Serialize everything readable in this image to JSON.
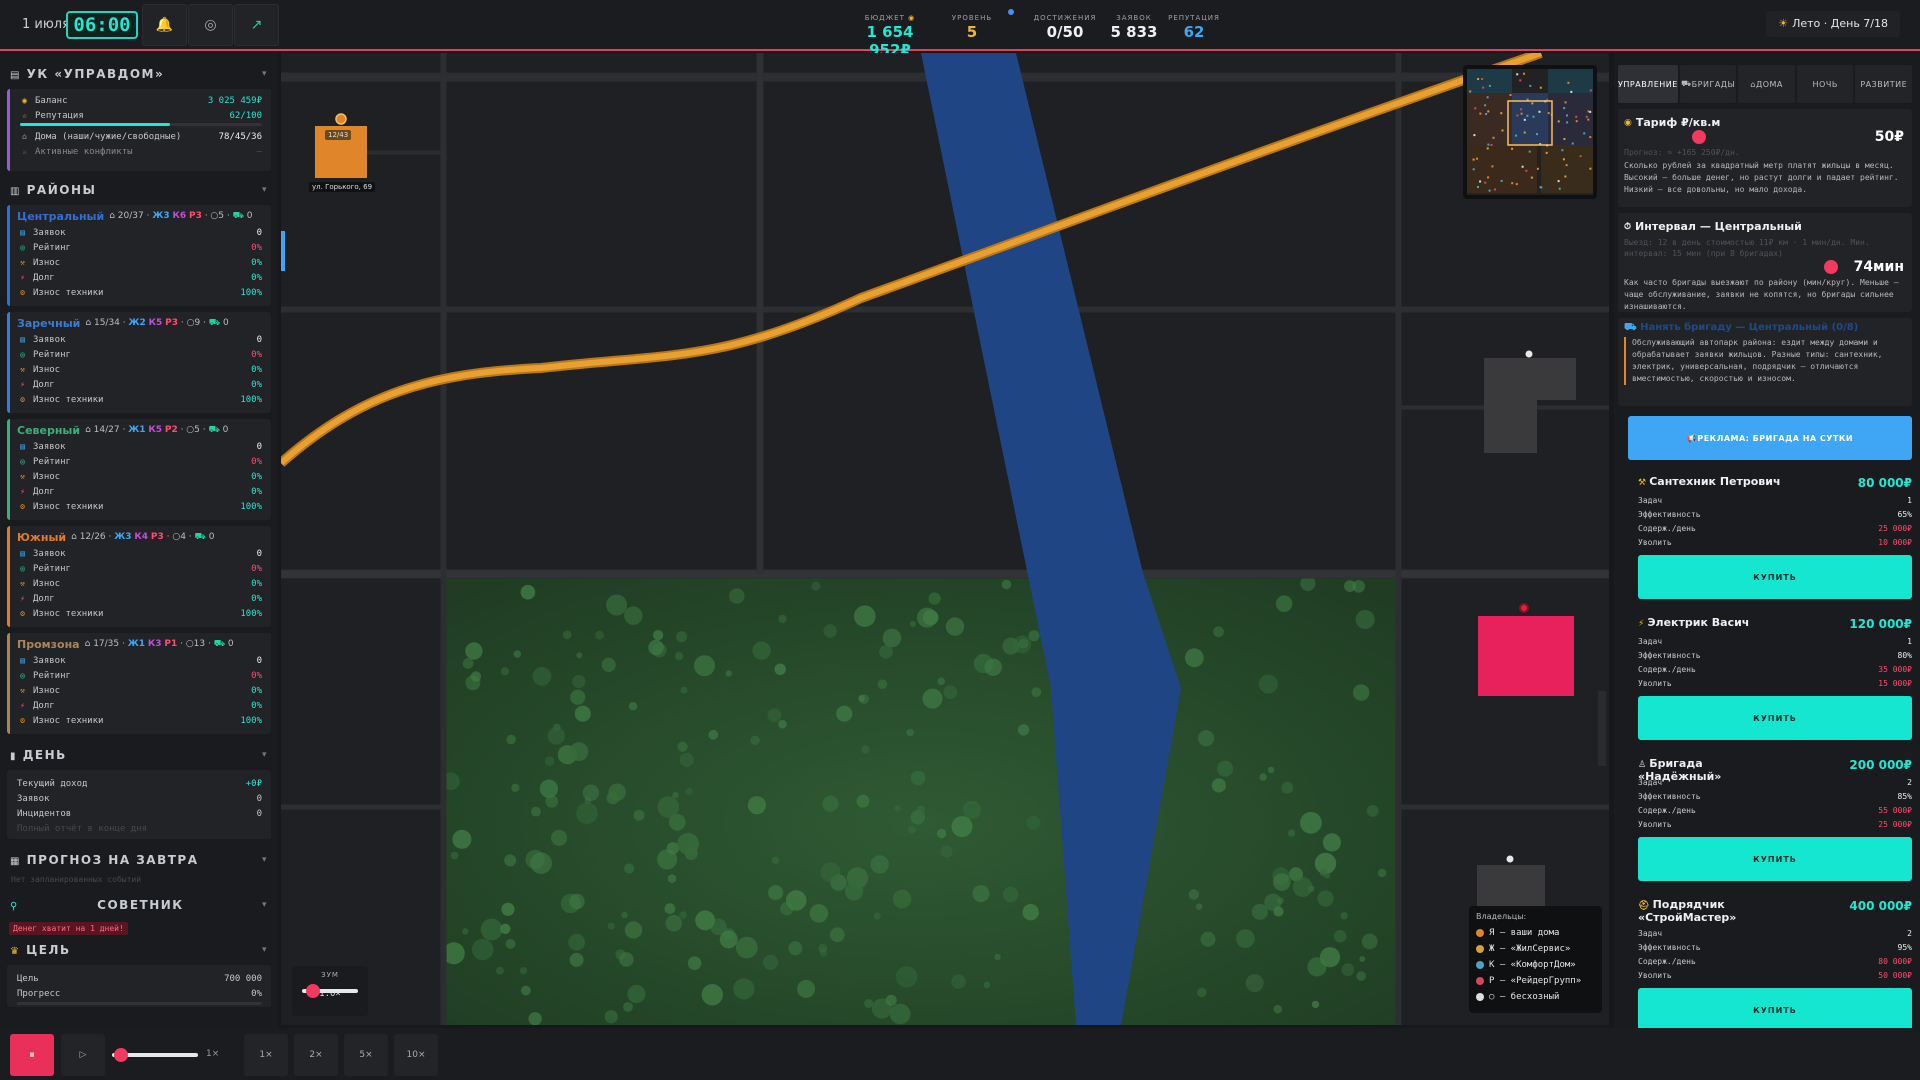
{
  "topbar": {
    "date": "1 июля",
    "time": "06:00",
    "budget_label": "БЮДЖЕТ",
    "budget_value": "1 654 952₽",
    "level_label": "УРОВЕНЬ",
    "level_value": "5",
    "achievements_label": "ДОСТИЖЕНИЯ",
    "achievements_value": "0/50",
    "requests_label": "ЗАЯВОК",
    "requests_value": "5 833",
    "reputation_label": "РЕПУТАЦИЯ",
    "reputation_value": "62",
    "season": "Лето · День 7/18"
  },
  "company": {
    "title": "УК «УПРАВДОМ»",
    "balance_label": "Баланс",
    "balance_value": "3 025 459₽",
    "reputation_label": "Репутация",
    "reputation_value": "62/100",
    "reputation_fraction": 0.62,
    "houses_label": "Дома (наши/чужие/свободные)",
    "houses_value": "78/45/36",
    "conflicts_label": "Активные конфликты",
    "conflicts_value": "—"
  },
  "districts_title": "РАЙОНЫ",
  "district_row_labels": [
    "Заявок",
    "Рейтинг",
    "Износ",
    "Долг",
    "Износ техники"
  ],
  "districts": [
    {
      "name": "Центральный",
      "color": "#2f6fd6",
      "houses": "20/37",
      "zh": "Ж3",
      "k": "К6",
      "r": "Р3",
      "free": "5",
      "brigades": "0",
      "values": [
        "0",
        "0%",
        "0%",
        "0%",
        "100%"
      ]
    },
    {
      "name": "Заречный",
      "color": "#3a7bd5",
      "houses": "15/34",
      "zh": "Ж2",
      "k": "К5",
      "r": "Р3",
      "free": "9",
      "brigades": "0",
      "values": [
        "0",
        "0%",
        "0%",
        "0%",
        "100%"
      ]
    },
    {
      "name": "Северный",
      "color": "#3fae7a",
      "houses": "14/27",
      "zh": "Ж1",
      "k": "К5",
      "r": "Р2",
      "free": "5",
      "brigades": "0",
      "values": [
        "0",
        "0%",
        "0%",
        "0%",
        "100%"
      ]
    },
    {
      "name": "Южный",
      "color": "#e07b33",
      "houses": "12/26",
      "zh": "Ж3",
      "k": "К4",
      "r": "Р3",
      "free": "4",
      "brigades": "0",
      "values": [
        "0",
        "0%",
        "0%",
        "0%",
        "100%"
      ]
    },
    {
      "name": "Промзона",
      "color": "#a9865a",
      "houses": "17/35",
      "zh": "Ж1",
      "k": "К3",
      "r": "Р1",
      "free": "13",
      "brigades": "0",
      "values": [
        "0",
        "0%",
        "0%",
        "0%",
        "100%"
      ]
    }
  ],
  "day": {
    "title": "ДЕНЬ",
    "income_label": "Текущий доход",
    "income_value": "+0₽",
    "requests_label": "Заявок",
    "requests_value": "0",
    "incidents_label": "Инцидентов",
    "incidents_value": "0",
    "note": "Полный отчёт в конце дня"
  },
  "forecast": {
    "title": "ПРОГНОЗ НА ЗАВТРА",
    "text": "Нет запланированных событий"
  },
  "advisor": {
    "title": "СОВЕТНИК",
    "warning": "Денег хватит на 1 дней!"
  },
  "goal": {
    "title": "ЦЕЛЬ",
    "goal_label": "Цель",
    "goal_value": "700 000",
    "progress_label": "Прогресс",
    "progress_value": "0%"
  },
  "map": {
    "building_counter": "12/43",
    "building_address": "ул. Горького, 69",
    "zoom_label": "ЗУМ",
    "zoom_value": "1.0×",
    "legend_title": "Владельцы:",
    "legend": [
      {
        "color": "#e0852a",
        "label": "Я — ваши дома"
      },
      {
        "color": "#d7a132",
        "label": "Ж — «ЖилСервис»"
      },
      {
        "color": "#4aa3c4",
        "label": "К — «КомфортДом»"
      },
      {
        "color": "#d04a5c",
        "label": "Р — «РейдерГрупп»"
      },
      {
        "color": "#dddddd",
        "label": "○ — бесхозный"
      }
    ]
  },
  "right": {
    "tabs": [
      "УПРАВЛЕНИЕ",
      "БРИГАДЫ",
      "ДОМА",
      "НОЧЬ",
      "РАЗВИТИЕ"
    ],
    "tariff_title": "Тариф ₽/кв.м",
    "tariff_value": "50₽",
    "tariff_hint": "Прогноз: ≈ +165 250₽/дн.",
    "tariff_desc": "Сколько рублей за квадратный метр платят жильцы в месяц. Высокий — больше денег, но растут долги и падает рейтинг. Низкий — все довольны, но мало дохода.",
    "interval_title": "Интервал — Центральный",
    "interval_hint": "Выезд: 12 в день стоимостью 11₽ км · 1 мин/дн. Мин. интервал: 15 мин (при 8 бригадах)",
    "interval_value": "74мин",
    "interval_desc": "Как часто бригады выезжают по району (мин/круг). Меньше — чаще обслуживание, заявки не копятся, но бригады сильнее изнашиваются.",
    "hire_title": "Нанять бригаду — Центральный (0/8)",
    "hire_desc": "Обслуживающий автопарк района: ездит между домами и обрабатывает заявки жильцов. Разные типы: сантехник, электрик, универсальная, подрядчик — отличаются вместимостью, скоростью и износом.",
    "ad_button": "РЕКЛАМА: БРИГАДА НА СУТКИ",
    "offer_row_labels": [
      "Задач",
      "Эффективность",
      "Содерж./день",
      "Уволить"
    ],
    "buy_label": "КУПИТЬ",
    "offers": [
      {
        "name": "Сантехник Петрович",
        "price": "80 000₽",
        "values": [
          "1",
          "65%",
          "25 000₽",
          "10 000₽"
        ]
      },
      {
        "name": "Электрик Васич",
        "price": "120 000₽",
        "values": [
          "1",
          "80%",
          "35 000₽",
          "15 000₽"
        ]
      },
      {
        "name": "Бригада «Надёжный»",
        "price": "200 000₽",
        "values": [
          "2",
          "85%",
          "55 000₽",
          "25 000₽"
        ]
      },
      {
        "name": "Подрядчик «СтройМастер»",
        "price": "400 000₽",
        "values": [
          "2",
          "95%",
          "80 000₽",
          "50 000₽"
        ]
      }
    ]
  },
  "bottom": {
    "speed_label": "1×",
    "speeds": [
      "1×",
      "2×",
      "5×",
      "10×"
    ]
  }
}
